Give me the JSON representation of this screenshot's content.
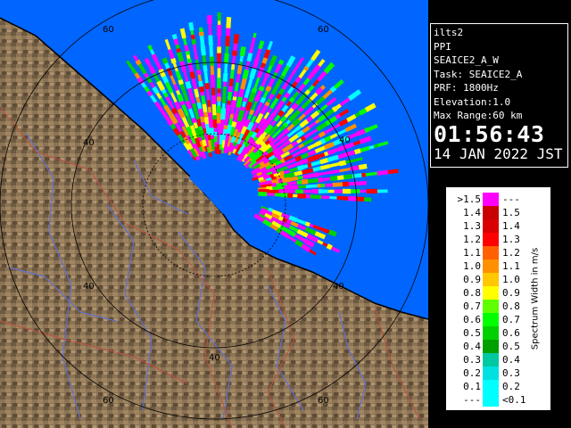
{
  "radar": {
    "range_labels": [
      "60",
      "60",
      "40",
      "40",
      "40",
      "40",
      "40",
      "60",
      "60"
    ]
  },
  "info": {
    "site": "ilts2",
    "scan_type": "PPI",
    "scan_name": "SEAICE2_A_W",
    "task": "Task: SEAICE2_A",
    "prf": "PRF: 1800Hz",
    "elevation": "Elevation:1.0",
    "max_range": "Max Range:60 km",
    "time": "01:56:43",
    "date": "14 JAN 2022 JST"
  },
  "legend": {
    "unit": "Spectrum Width in m/s",
    "rows": [
      {
        "left": ">1.5",
        "right": "---",
        "color": "#ff00ff"
      },
      {
        "left": "1.4",
        "right": "1.5",
        "color": "#c80000"
      },
      {
        "left": "1.3",
        "right": "1.4",
        "color": "#d80000"
      },
      {
        "left": "1.2",
        "right": "1.3",
        "color": "#ff0000"
      },
      {
        "left": "1.1",
        "right": "1.2",
        "color": "#ff6000"
      },
      {
        "left": "1.0",
        "right": "1.1",
        "color": "#ff9000"
      },
      {
        "left": "0.9",
        "right": "1.0",
        "color": "#ffc800"
      },
      {
        "left": "0.8",
        "right": "0.9",
        "color": "#ffff00"
      },
      {
        "left": "0.7",
        "right": "0.8",
        "color": "#60ff00"
      },
      {
        "left": "0.6",
        "right": "0.7",
        "color": "#00ff00"
      },
      {
        "left": "0.5",
        "right": "0.6",
        "color": "#00d000"
      },
      {
        "left": "0.4",
        "right": "0.5",
        "color": "#00a000"
      },
      {
        "left": "0.3",
        "right": "0.4",
        "color": "#00c8a0"
      },
      {
        "left": "0.2",
        "right": "0.3",
        "color": "#00e0e0"
      },
      {
        "left": "0.1",
        "right": "0.2",
        "color": "#00ffff"
      },
      {
        "left": "---",
        "right": "<0.1",
        "color": "#00ffff"
      }
    ]
  },
  "colors": {
    "sea": "#0066ff",
    "land": "#8b7355",
    "rivers": "#6070d0",
    "boundaries": "#c05040",
    "range_rings": "#000000"
  }
}
